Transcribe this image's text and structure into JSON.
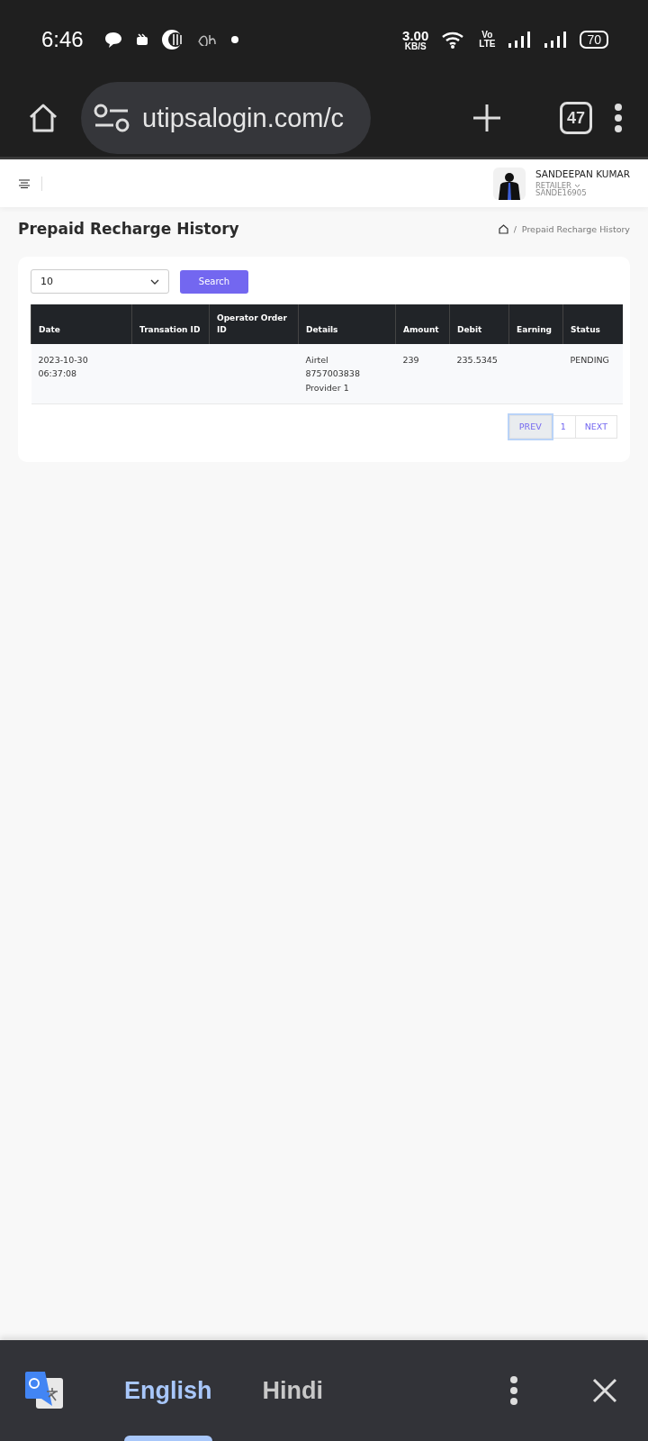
{
  "status_bar": {
    "time": "6:46",
    "speed": "3.00",
    "speed_unit": "KB/S",
    "volte_top": "Vo",
    "volte_bottom": "LTE",
    "battery": "70"
  },
  "browser": {
    "url": "utipsalogin.com/c",
    "tab_count": "47"
  },
  "header": {
    "user_name": "SANDEEPAN KUMAR",
    "role": "RETAILER",
    "user_id": "SANDE16905"
  },
  "page": {
    "title": "Prepaid Recharge History",
    "breadcrumb_separator": "/",
    "breadcrumb": "Prepaid Recharge History"
  },
  "filter": {
    "page_size": "10",
    "search_button": "Search"
  },
  "table": {
    "columns": [
      "Date",
      "Transation ID",
      "Operator Order ID",
      "Details",
      "Amount",
      "Debit",
      "Earning",
      "Status"
    ],
    "rows": [
      {
        "cells": [
          [
            "2023-10-30",
            "06:37:08"
          ],
          [],
          [],
          [
            "Airtel",
            "8757003838",
            "Provider 1"
          ],
          [
            "239"
          ],
          [
            "235.5345"
          ],
          [],
          [
            "PENDING"
          ]
        ]
      }
    ]
  },
  "pagination": [
    {
      "label": "PREV",
      "focused": true
    },
    {
      "label": "1",
      "focused": false
    },
    {
      "label": "NEXT",
      "focused": false
    }
  ],
  "translate_bar": {
    "tabs": [
      {
        "label": "English",
        "selected": true
      },
      {
        "label": "Hindi",
        "selected": false
      }
    ]
  }
}
